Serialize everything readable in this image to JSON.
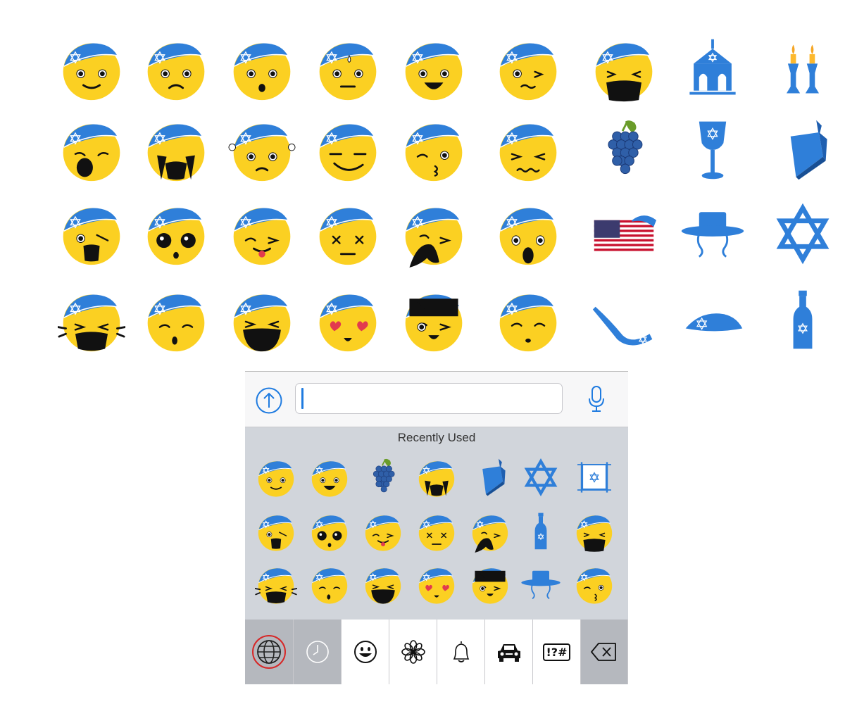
{
  "gallery": {
    "rows": [
      [
        "kippah-emoji-smile",
        "kippah-emoji-frown",
        "kippah-emoji-surprised",
        "kippah-emoji-sweat",
        "kippah-emoji-grin",
        "kippah-emoji-grimace",
        "kippah-emoji-crying-loud",
        "synagogue-icon",
        "shabbat-candles-icon"
      ],
      [
        "kippah-emoji-yawn",
        "kippah-emoji-sobbing",
        "kippah-emoji-steaming",
        "kippah-emoji-smirk",
        "kippah-emoji-kiss-wink",
        "kippah-emoji-squint-wavy",
        "grapes-icon",
        "kiddush-cup-icon",
        "dreidel-icon"
      ],
      [
        "kippah-emoji-shocked",
        "kippah-emoji-dizzy-eyes",
        "kippah-emoji-tongue-wink",
        "kippah-emoji-dead-eyes",
        "kippah-emoji-mustache",
        "kippah-emoji-gasp",
        "american-flag-kippah-icon",
        "hasidic-hat-icon",
        "star-of-david-icon"
      ],
      [
        "kippah-emoji-laugh-tears",
        "kippah-emoji-whistle",
        "kippah-emoji-big-laugh",
        "kippah-emoji-heart-eyes",
        "kippah-emoji-sunglasses",
        "kippah-emoji-blush",
        "shofar-icon",
        "kippah-icon",
        "wine-bottle-icon"
      ]
    ]
  },
  "keyboard": {
    "input_placeholder": "",
    "input_value": "",
    "section_title": "Recently Used",
    "recent_rows": [
      [
        "kippah-emoji-smile",
        "kippah-emoji-grin",
        "grapes-icon",
        "kippah-emoji-sobbing",
        "dreidel-icon",
        "star-of-david-icon",
        "torah-scroll-icon"
      ],
      [
        "kippah-emoji-shocked",
        "kippah-emoji-dizzy-eyes",
        "kippah-emoji-tongue-wink",
        "kippah-emoji-dead-eyes",
        "kippah-emoji-mustache",
        "wine-bottle-icon",
        "kippah-emoji-crying-loud"
      ],
      [
        "kippah-emoji-laugh-tears",
        "kippah-emoji-whistle",
        "kippah-emoji-big-laugh",
        "kippah-emoji-heart-eyes",
        "kippah-emoji-sunglasses",
        "hasidic-hat-icon",
        "kippah-emoji-kiss-wink"
      ]
    ],
    "toolbar": {
      "buttons": [
        "globe-icon",
        "recent-clock-icon",
        "smiley-icon",
        "flower-icon",
        "bell-icon",
        "car-icon",
        "symbols-button",
        "backspace-icon"
      ],
      "symbols_label": "!?#",
      "selected": "recent-clock-icon"
    },
    "colors": {
      "kippah_blue": "#2f7fd9",
      "face_yellow": "#fbd022",
      "accent_blue": "#1f7be0",
      "globe_highlight": "#d62828"
    }
  }
}
